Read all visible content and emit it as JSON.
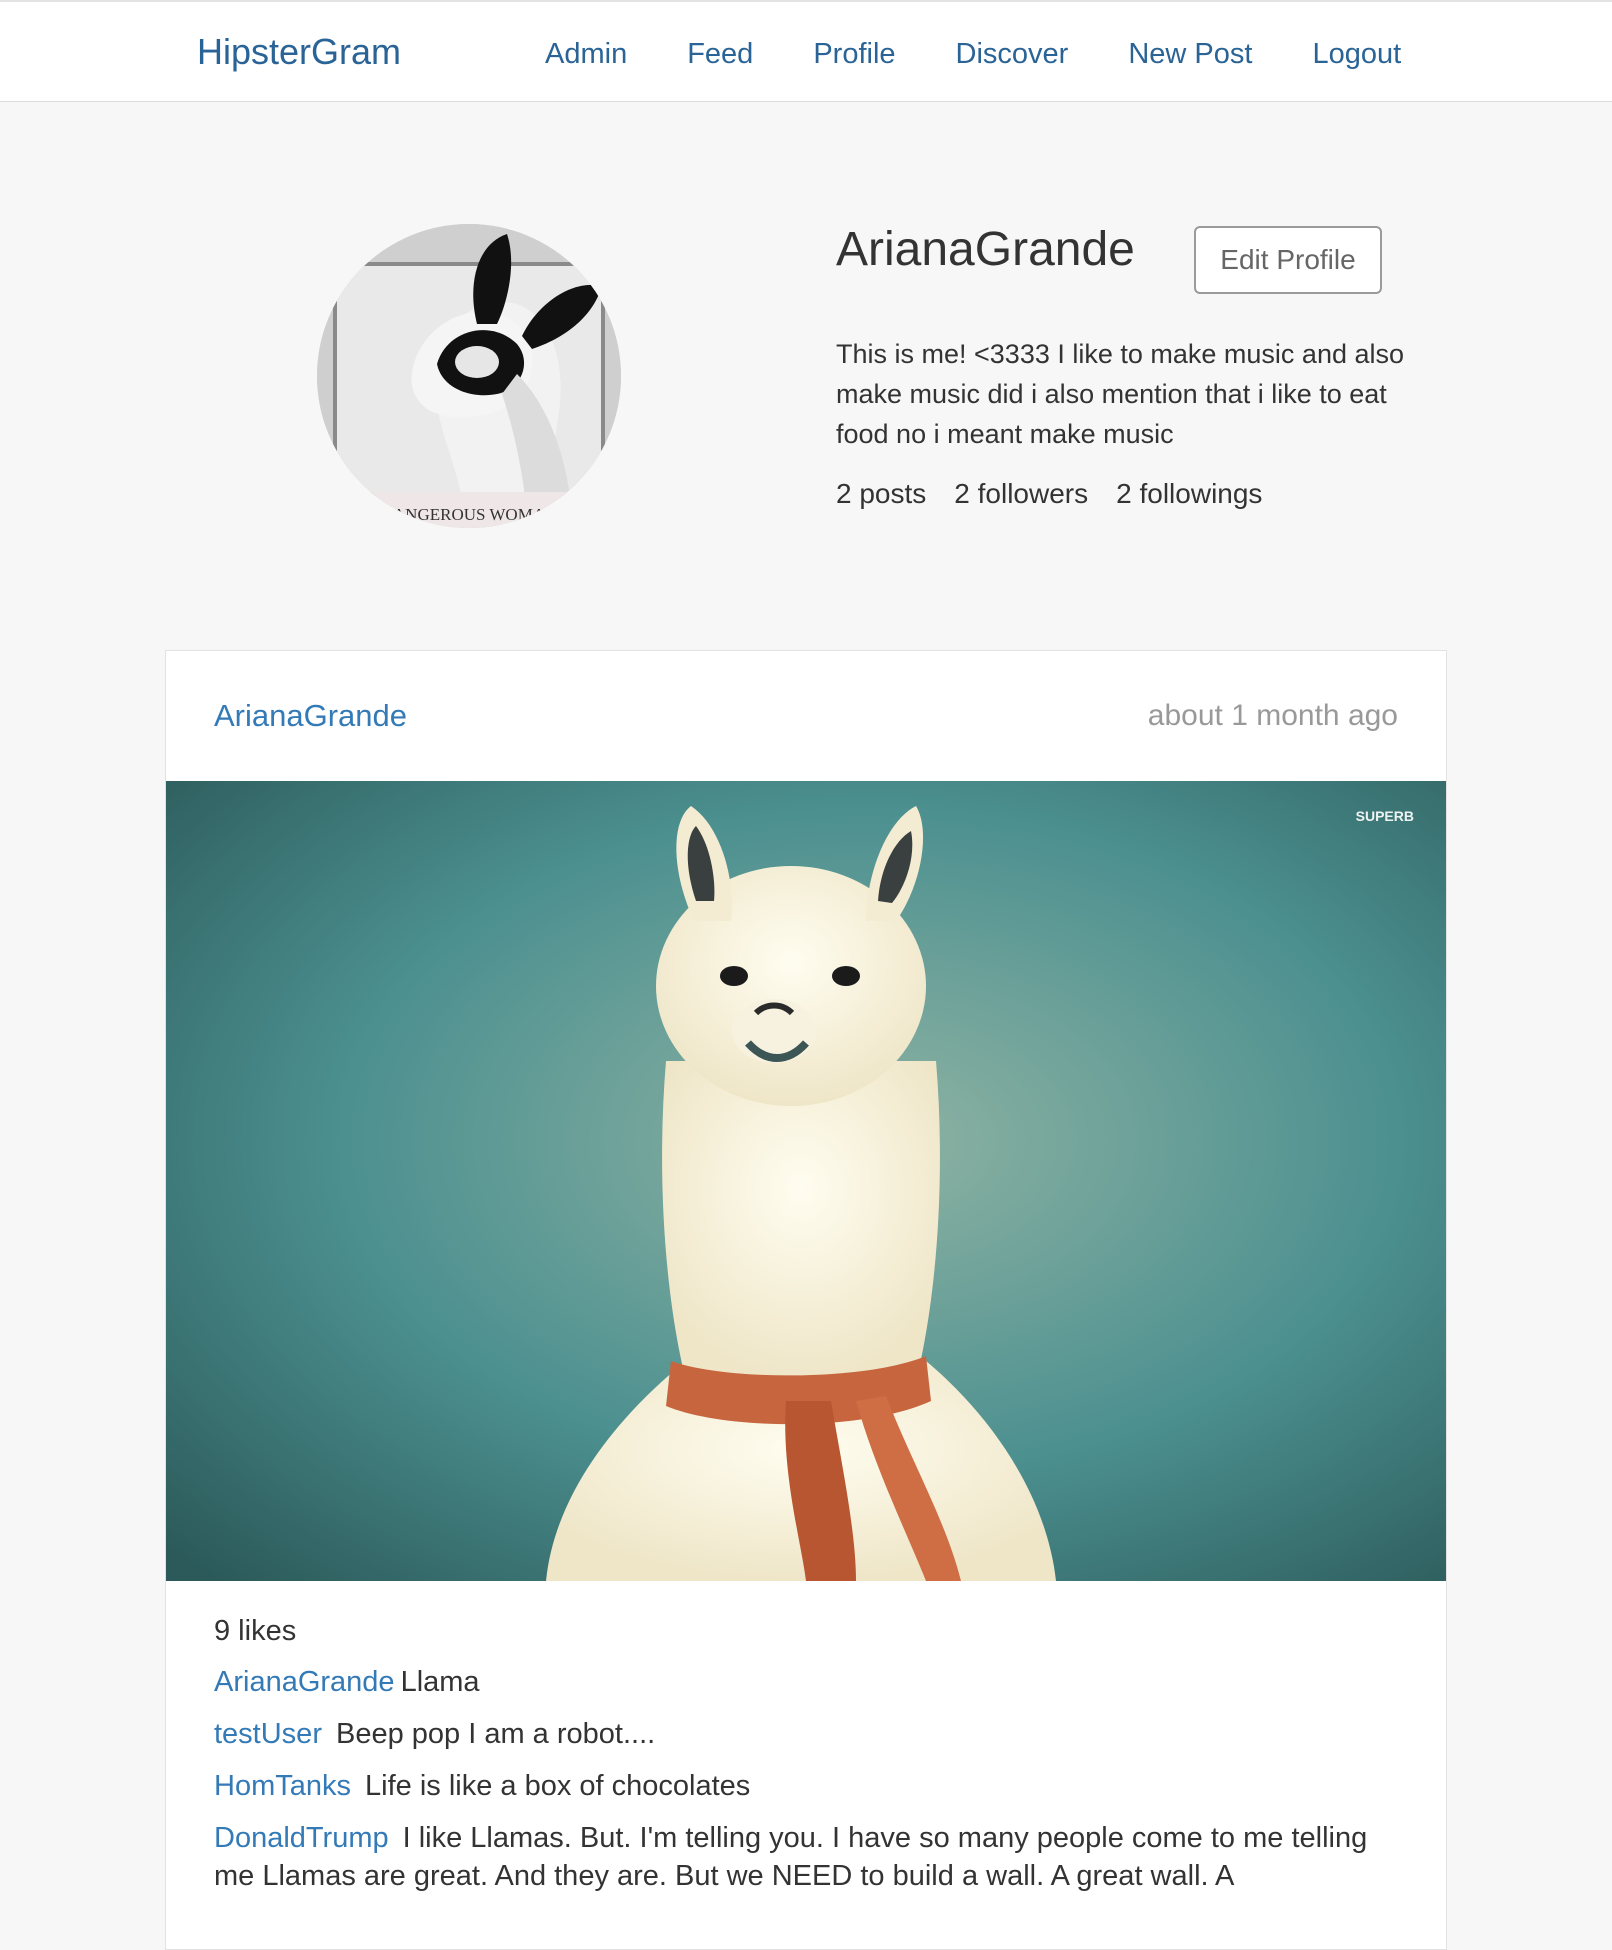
{
  "nav": {
    "brand": "HipsterGram",
    "links": [
      "Admin",
      "Feed",
      "Profile",
      "Discover",
      "New Post",
      "Logout"
    ]
  },
  "profile": {
    "username": "ArianaGrande",
    "edit_button": "Edit Profile",
    "bio": "This is me! <3333 I like to make music and also make music did i also mention that i like to eat food no i meant make music",
    "stats": {
      "posts": "2 posts",
      "followers": "2 followers",
      "followings": "2 followings"
    },
    "avatar_caption": "DANGEROUS WOMAN"
  },
  "post": {
    "author": "ArianaGrande",
    "time": "about 1 month ago",
    "image_watermark": "SUPERB",
    "likes": "9 likes",
    "comments": [
      {
        "user": "ArianaGrande",
        "text": "Llama"
      },
      {
        "user": "testUser",
        "text": "Beep pop I am a robot...."
      },
      {
        "user": "HomTanks",
        "text": "Life is like a box of chocolates"
      },
      {
        "user": "DonaldTrump",
        "text": "I like Llamas. But. I'm telling you. I have so many people come to me telling me Llamas are great. And they are. But we NEED to build a wall. A great wall. A"
      }
    ]
  }
}
